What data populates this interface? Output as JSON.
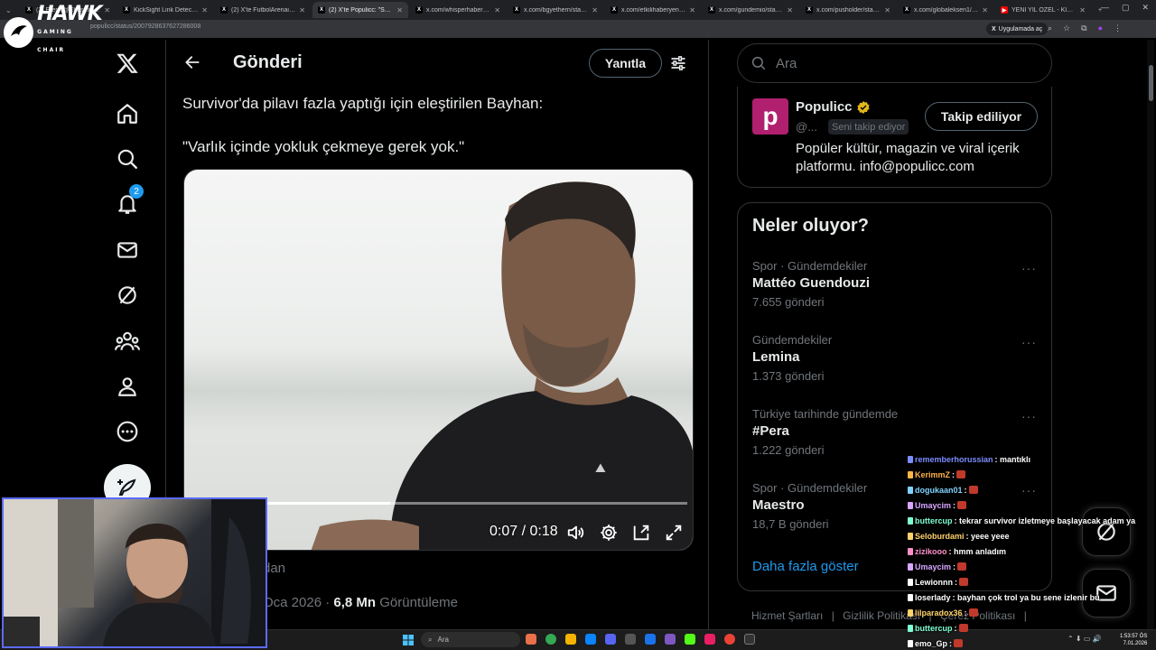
{
  "browser": {
    "tabs": [
      {
        "label": "(2) Eren (@Ebuselmnbelas",
        "icon": "x-icon"
      },
      {
        "label": "KickSight Link Detector",
        "icon": "x-icon"
      },
      {
        "label": "(2) X'te FutbolArenai: \"Lio",
        "icon": "x-icon"
      },
      {
        "label": "(2) X'te Populicc: \"Survivo",
        "icon": "x-icon"
      },
      {
        "label": "x.com/whisperhaber/statu",
        "icon": "x-icon"
      },
      {
        "label": "x.com/bgyethern/status/2",
        "icon": "x-icon"
      },
      {
        "label": "x.com/etkilihaberyeni/sta",
        "icon": "x-icon"
      },
      {
        "label": "x.com/gundemio/status/2",
        "icon": "x-icon"
      },
      {
        "label": "x.com/pusholder/status/2",
        "icon": "x-icon"
      },
      {
        "label": "x.com/globaleksen1/stat",
        "icon": "x-icon"
      },
      {
        "label": "YENİ YIL ÖZEL - KİCK WF",
        "icon": "youtube-icon"
      }
    ],
    "active_tab_index": 3,
    "url": "populicc/status/2007928637627286008",
    "open_in_app_label": "Uygulamada aç"
  },
  "overlay": {
    "logo_text": "HAWK",
    "logo_sub": "GAMING CHAIR"
  },
  "nav": {
    "notification_count": "2",
    "items": [
      "x-logo-icon",
      "home-icon",
      "search-icon",
      "bell-icon",
      "mail-icon",
      "grok-icon",
      "communities-icon",
      "profile-icon",
      "more-icon"
    ]
  },
  "post": {
    "header_title": "Gönderi",
    "reply_label": "Yanıtla",
    "text_line1": "Survivor'da pilavı fazla yaptığı için eleştirilen Bayhan:",
    "text_line2": "\"Varlık içinde yokluk çekmeye gerek yok.\"",
    "video": {
      "time": "0:07 / 0:18",
      "progress": 0.39
    },
    "meta_partial": "dan",
    "date_partial": "Oca 2026",
    "separator": "·",
    "views_value": "6,8 Mn",
    "views_label": "Görüntüleme"
  },
  "sidebar": {
    "search_placeholder": "Ara",
    "profile": {
      "name": "Populicc",
      "handle": "@...",
      "follows_you": "Seni takip ediyor",
      "follow_button": "Takip ediliyor",
      "bio": "Popüler kültür, magazin ve viral içerik platformu. info@populicc.com"
    },
    "trends_title": "Neler oluyor?",
    "trends": [
      {
        "context": "Spor · Gündemdekiler",
        "name": "Mattéo Guendouzi",
        "count": "7.655 gönderi"
      },
      {
        "context": "Gündemdekiler",
        "name": "Lemina",
        "count": "1.373 gönderi"
      },
      {
        "context": "Türkiye tarihinde gündemde",
        "name": "#Pera",
        "count": "1.222 gönderi"
      },
      {
        "context": "Spor · Gündemdekiler",
        "name": "Maestro",
        "count": "18,7 B gönderi"
      }
    ],
    "more_label": "···",
    "show_more": "Daha fazla göster",
    "footer": [
      "Hizmet Şartları",
      "Gizlilik Politikası",
      "Çerez Politikası"
    ],
    "footer_sep": "|"
  },
  "chat": {
    "messages": [
      {
        "user": "rememberhorussian",
        "text": ": mantıklı",
        "color": "#7b8cff",
        "emote": false
      },
      {
        "user": "KerimmZ",
        "text": ":",
        "color": "#ffb347",
        "emote": true
      },
      {
        "user": "dogukaan01",
        "text": ":",
        "color": "#7fd3ff",
        "emote": true
      },
      {
        "user": "Umaycim",
        "text": ":",
        "color": "#d7a6ff",
        "emote": true
      },
      {
        "user": "buttercup",
        "text": ": tekrar survivor izletmeye başlayacak adam ya",
        "color": "#7fffd4",
        "emote": false
      },
      {
        "user": "Seloburdami",
        "text": ": yeee yeee",
        "color": "#ffd36b",
        "emote": false
      },
      {
        "user": "zizikooo",
        "text": ": hmm anladım",
        "color": "#ff8fc7",
        "emote": false
      },
      {
        "user": "Umaycim",
        "text": ":",
        "color": "#d7a6ff",
        "emote": true
      },
      {
        "user": "Lewionnn",
        "text": ":",
        "color": "#ffffff",
        "emote": true
      },
      {
        "user": "loserlady",
        "text": ": bayhan çok trol ya bu sene izlenir bu",
        "color": "#ffffff",
        "emote": false
      },
      {
        "user": "lilparadox36",
        "text": ":",
        "color": "#ffd36b",
        "emote": true
      },
      {
        "user": "buttercup",
        "text": ":",
        "color": "#7fffd4",
        "emote": true
      },
      {
        "user": "emo_Gp",
        "text": ":",
        "color": "#ffffff",
        "emote": true
      }
    ]
  },
  "taskbar": {
    "search_label": "Ara",
    "time": "1:53:57 ÖS",
    "date": "7.01.2026"
  },
  "colors": {
    "accent": "#1d9bf0",
    "border": "#2f3336",
    "muted": "#71767b"
  }
}
